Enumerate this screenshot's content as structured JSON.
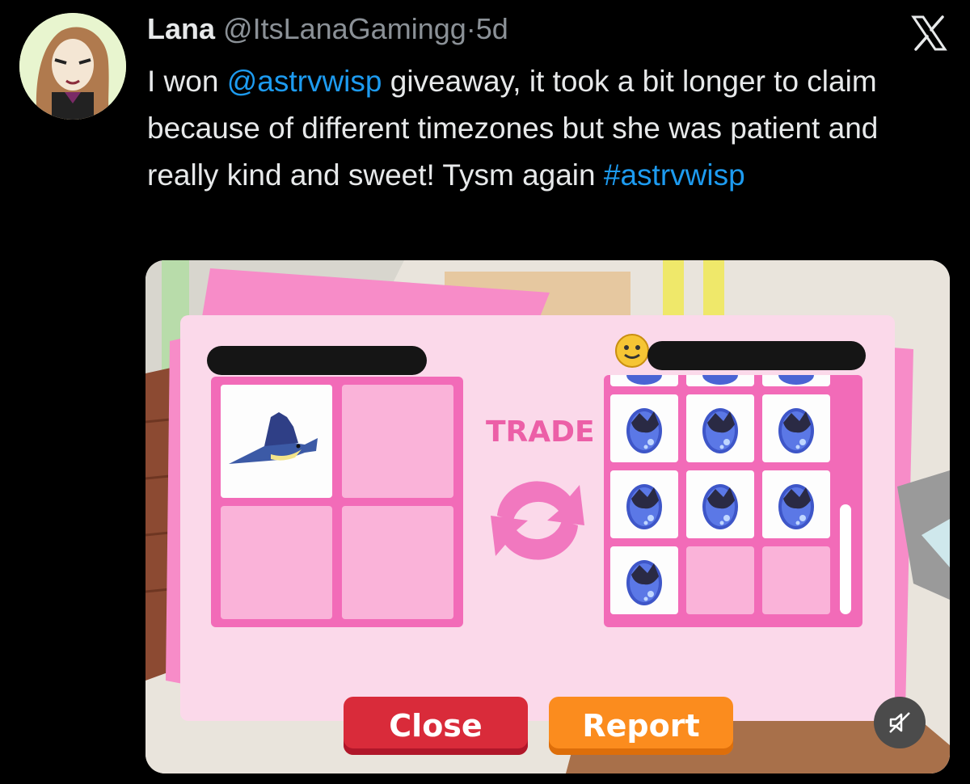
{
  "tweet": {
    "author_name": "Lana",
    "author_handle": "@ItsLanaGamingg",
    "separator": "·",
    "time_ago": "5d",
    "text": {
      "part1": "I won ",
      "mention": "@astrvwisp",
      "part2": " giveaway, it took a bit longer to claim because of different timezones but she was patient and really kind and sweet! Tysm again ",
      "hashtag": "#astrvwisp"
    }
  },
  "icons": {
    "brand": "x-logo-icon",
    "mute": "muted-speaker-icon",
    "trade": "trade-arrows-icon",
    "player_face": "smiley-face-icon",
    "item_fish": "sailfish-icon",
    "item_egg": "ocean-egg-icon"
  },
  "media": {
    "trade_window": {
      "trade_label": "TRADE",
      "close_label": "Close",
      "report_label": "Report",
      "left_offer": [
        "sailfish",
        "",
        "",
        ""
      ],
      "right_offer": [
        "ocean-egg",
        "ocean-egg",
        "ocean-egg",
        "ocean-egg",
        "ocean-egg",
        "ocean-egg",
        "ocean-egg",
        "",
        ""
      ]
    }
  },
  "colors": {
    "link": "#1d9bf0",
    "panel": "#fbd9ea",
    "grid": "#f26bb8",
    "close_button": "#d92b3a",
    "report_button": "#fb8c1e"
  }
}
